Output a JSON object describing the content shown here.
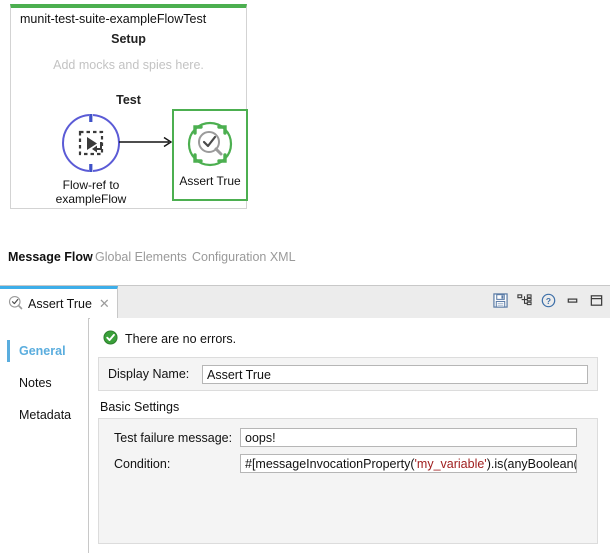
{
  "canvas": {
    "flow_title": "munit-test-suite-exampleFlowTest",
    "setup_label": "Setup",
    "setup_placeholder": "Add mocks and spies here.",
    "test_label": "Test",
    "border_color": "#4caf50",
    "nodes": [
      {
        "id": "flow-ref",
        "icon": "flow-ref-icon",
        "label_line1": "Flow-ref to",
        "label_line2": "exampleFlow",
        "accent_color": "#5b5bd6",
        "selected": false
      },
      {
        "id": "assert-true",
        "icon": "assert-true-icon",
        "label_line1": "Assert True",
        "label_line2": "",
        "accent_color": "#4caf50",
        "selected": true
      }
    ],
    "connector": "arrow-right"
  },
  "editor_tabs": [
    {
      "label": "Message Flow",
      "active": true
    },
    {
      "label": "Global Elements",
      "active": false
    },
    {
      "label": "Configuration XML",
      "active": false
    }
  ],
  "properties": {
    "tab": {
      "icon": "assert-true-icon",
      "label": "Assert True",
      "close_icon": "close-icon",
      "accent_color": "#3daee9"
    },
    "toolbar": [
      {
        "name": "save-icon",
        "title": "Save"
      },
      {
        "name": "hierarchy-icon",
        "title": "Show hierarchy"
      },
      {
        "name": "help-icon",
        "title": "Help"
      },
      {
        "name": "minimize-icon",
        "title": "Minimize"
      },
      {
        "name": "maximize-icon",
        "title": "Maximize"
      }
    ],
    "nav_items": [
      {
        "label": "General",
        "selected": true
      },
      {
        "label": "Notes",
        "selected": false
      },
      {
        "label": "Metadata",
        "selected": false
      }
    ],
    "status": {
      "icon": "success-check-icon",
      "text": "There are no errors.",
      "color": "#3aa03a"
    },
    "display_name": {
      "label": "Display Name:",
      "value": "Assert True",
      "placeholder": ""
    },
    "basic_settings": {
      "title": "Basic Settings",
      "fields": [
        {
          "label": "Test failure message:",
          "value": "oops!",
          "placeholder": ""
        },
        {
          "label": "Condition:",
          "value": "#[messageInvocationProperty('my_variable').is(anyBoolean())]",
          "value_prefix": "#[messageInvocationProperty(",
          "value_literal": "'my_variable'",
          "value_suffix": ").is(anyBoolean())]",
          "placeholder": ""
        }
      ]
    }
  }
}
